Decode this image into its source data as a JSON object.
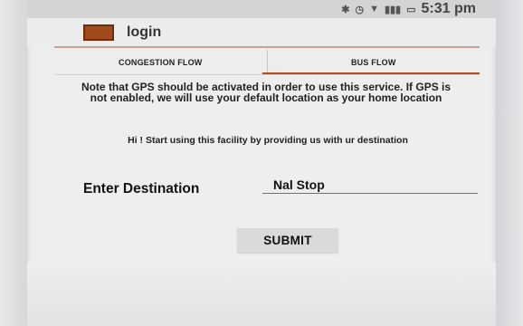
{
  "status_bar": {
    "time": "5:31 pm"
  },
  "app_bar": {
    "title": "login"
  },
  "tabs": [
    {
      "label": "CONGESTION FLOW"
    },
    {
      "label": "BUS FLOW"
    }
  ],
  "main": {
    "note": "Note that GPS should be activated in order to use this service. If GPS is not enabled, we will use your default location as your home location",
    "intro": "Hi ! Start using this facility by providing us with ur destination",
    "destination_label": "Enter Destination",
    "destination_value": "Nal Stop",
    "submit_label": "SUBMIT"
  },
  "colors": {
    "accent": "#b84c1e",
    "icon": "#a24a1b"
  }
}
